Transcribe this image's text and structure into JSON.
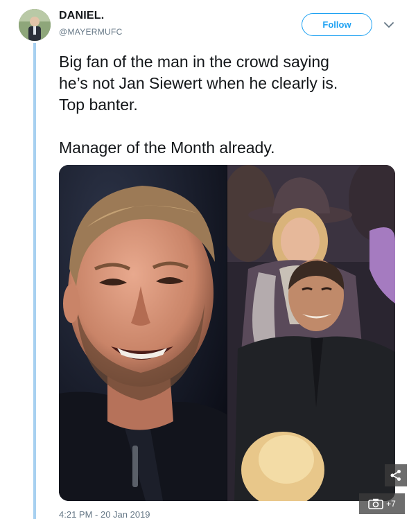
{
  "author": {
    "display_name": "DANIEL.",
    "handle": "@MAYERMUFC"
  },
  "follow_label": "Follow",
  "tweet": {
    "lines": [
      "Big fan of the man in the crowd saying",
      "he’s not Jan Siewert when he clearly is.",
      "Top banter."
    ],
    "closing_line": "Manager of the Month already."
  },
  "media": {
    "photo_count": 2,
    "extra_label": "+7"
  },
  "icons": [
    "chevron-down-icon",
    "share-icon",
    "camera-icon"
  ],
  "timestamp": "4:21 PM - 20 Jan 2019",
  "colors": {
    "accent": "#1da1f2",
    "thread_line": "#a7d0f0",
    "muted_text": "#657786"
  }
}
